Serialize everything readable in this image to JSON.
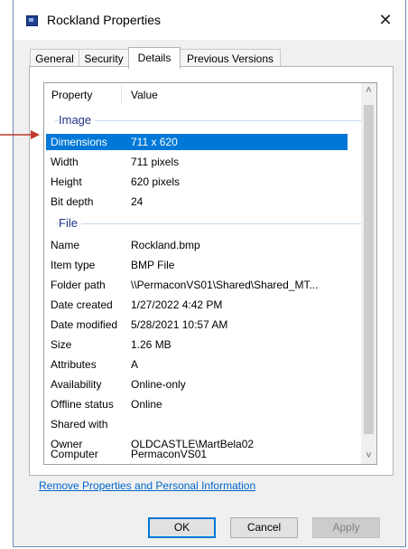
{
  "window": {
    "title": "Rockland Properties"
  },
  "tabs": [
    {
      "label": "General"
    },
    {
      "label": "Security"
    },
    {
      "label": "Details"
    },
    {
      "label": "Previous Versions"
    }
  ],
  "active_tab": "Details",
  "details": {
    "columns": {
      "property": "Property",
      "value": "Value"
    },
    "groups": [
      {
        "label": "Image",
        "rows": [
          {
            "key": "Dimensions",
            "value": "711 x 620",
            "selected": true
          },
          {
            "key": "Width",
            "value": "711 pixels"
          },
          {
            "key": "Height",
            "value": "620 pixels"
          },
          {
            "key": "Bit depth",
            "value": "24"
          }
        ]
      },
      {
        "label": "File",
        "rows": [
          {
            "key": "Name",
            "value": "Rockland.bmp"
          },
          {
            "key": "Item type",
            "value": "BMP File"
          },
          {
            "key": "Folder path",
            "value": "\\\\PermaconVS01\\Shared\\Shared_MT..."
          },
          {
            "key": "Date created",
            "value": "1/27/2022 4:42 PM"
          },
          {
            "key": "Date modified",
            "value": "5/28/2021 10:57 AM"
          },
          {
            "key": "Size",
            "value": "1.26 MB"
          },
          {
            "key": "Attributes",
            "value": "A"
          },
          {
            "key": "Availability",
            "value": "Online-only"
          },
          {
            "key": "Offline status",
            "value": "Online"
          },
          {
            "key": "Shared with",
            "value": ""
          },
          {
            "key": "Owner",
            "value": "OLDCASTLE\\MartBela02"
          },
          {
            "key": "Computer",
            "value": "PermaconVS01"
          }
        ]
      }
    ]
  },
  "remove_link": "Remove Properties and Personal Information",
  "buttons": {
    "ok": "OK",
    "cancel": "Cancel",
    "apply": "Apply"
  },
  "colors": {
    "selection": "#0078d7",
    "group_header": "#1e3287",
    "link": "#0066cc",
    "annotation_arrow": "#c0392b"
  },
  "icons": {
    "window": "bmp-file-icon",
    "close": "close-icon",
    "scroll_up": "chevron-up-icon",
    "scroll_down": "chevron-down-icon",
    "annotation": "red-arrow-icon"
  }
}
